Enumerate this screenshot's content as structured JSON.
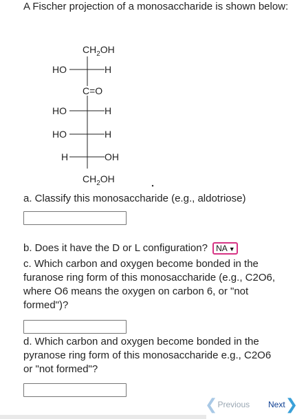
{
  "intro": "A Fischer projection of a monosaccharide is shown below:",
  "fischer": {
    "top": "CH₂OH",
    "rows": [
      {
        "left": "HO",
        "right": "H"
      },
      {
        "left": "",
        "right": "",
        "center": "C=O"
      },
      {
        "left": "HO",
        "right": "H"
      },
      {
        "left": "HO",
        "right": "H"
      },
      {
        "left": "H",
        "right": "OH"
      }
    ],
    "bottom": "CH₂OH"
  },
  "questions": {
    "a": "a. Classify this monosaccharide (e.g., aldotriose)",
    "b": "b. Does it have the D or L configuration?",
    "b_select": "NA",
    "c": "c. Which carbon and oxygen become bonded in the furanose ring form of this monosaccharide (e.g., C2O6, where O6 means the oxygen on carbon 6, or \"not formed\")?",
    "d": "d. Which carbon and oxygen become bonded in the pyranose ring form of this monosaccharide e.g., C2O6 or \"not formed\"?"
  },
  "answers": {
    "a": "",
    "c": "",
    "d": ""
  },
  "nav": {
    "previous": "Previous",
    "next": "Next"
  },
  "icons": {
    "select_chevron": "chevron-down-icon",
    "prev": "chevron-left-icon",
    "next": "chevron-right-icon"
  }
}
